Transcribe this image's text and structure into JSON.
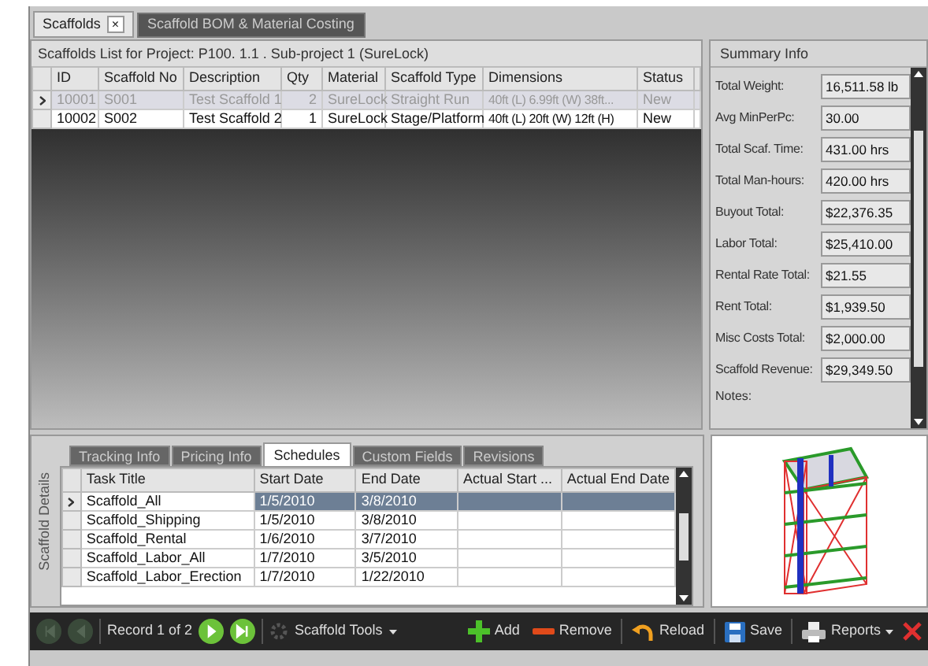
{
  "doc_tabs": [
    {
      "label": "Scaffolds",
      "selected": true,
      "close": "×"
    },
    {
      "label": "Scaffold BOM & Material Costing",
      "selected": false
    }
  ],
  "list_title": "Scaffolds List for Project: P100. 1.1 . Sub-project 1 (SureLock)",
  "scaffolds": {
    "columns": [
      "ID",
      "Scaffold No",
      "Description",
      "Qty",
      "Material",
      "Scaffold Type",
      "Dimensions",
      "Status"
    ],
    "rows": [
      {
        "selected": true,
        "cells": [
          "10001",
          "S001",
          "Test Scaffold 1",
          "2",
          "SureLock",
          "Straight Run",
          "40ft (L) 6.99ft (W) 38ft...",
          "New"
        ]
      },
      {
        "selected": false,
        "cells": [
          "10002",
          "S002",
          "Test Scaffold 2",
          "1",
          "SureLock",
          "Stage/Platform",
          "40ft (L) 20ft (W) 12ft (H)",
          "New"
        ]
      }
    ]
  },
  "summary": {
    "title": "Summary Info",
    "fields": [
      {
        "label": "Total Weight:",
        "value": "16,511.58 lb"
      },
      {
        "label": "Avg MinPerPc:",
        "value": "30.00"
      },
      {
        "label": "Total Scaf. Time:",
        "value": "431.00 hrs"
      },
      {
        "label": "Total Man-hours:",
        "value": "420.00 hrs"
      },
      {
        "label": "Buyout Total:",
        "value": "$22,376.35"
      },
      {
        "label": "Labor Total:",
        "value": "$25,410.00"
      },
      {
        "label": "Rental Rate Total:",
        "value": "$21.55"
      },
      {
        "label": "Rent Total:",
        "value": "$1,939.50"
      },
      {
        "label": "Misc Costs Total:",
        "value": "$2,000.00"
      },
      {
        "label": "Scaffold Revenue:",
        "value": "$29,349.50"
      }
    ],
    "notes_label": "Notes:"
  },
  "details_label": "Scaffold Details",
  "detail_tabs": [
    {
      "label": "Tracking Info",
      "selected": false
    },
    {
      "label": "Pricing Info",
      "selected": false
    },
    {
      "label": "Schedules",
      "selected": true
    },
    {
      "label": "Custom Fields",
      "selected": false
    },
    {
      "label": "Revisions",
      "selected": false
    }
  ],
  "schedules": {
    "columns": [
      "Task Title",
      "Start Date",
      "End Date",
      "Actual Start ...",
      "Actual End Date"
    ],
    "rows": [
      {
        "selected": true,
        "cells": [
          "Scaffold_All",
          "1/5/2010",
          "3/8/2010",
          "",
          ""
        ]
      },
      {
        "selected": false,
        "cells": [
          "Scaffold_Shipping",
          "1/5/2010",
          "3/8/2010",
          "",
          ""
        ]
      },
      {
        "selected": false,
        "cells": [
          "Scaffold_Rental",
          "1/6/2010",
          "3/7/2010",
          "",
          ""
        ]
      },
      {
        "selected": false,
        "cells": [
          "Scaffold_Labor_All",
          "1/7/2010",
          "3/5/2010",
          "",
          ""
        ]
      },
      {
        "selected": false,
        "cells": [
          "Scaffold_Labor_Erection",
          "1/7/2010",
          "1/22/2010",
          "",
          ""
        ]
      }
    ]
  },
  "toolbar": {
    "nav": [
      {
        "kind": "first",
        "disabled": true
      },
      {
        "kind": "prev",
        "disabled": true
      }
    ],
    "record": "Record 1 of 2",
    "nav2": [
      {
        "kind": "next",
        "disabled": false
      },
      {
        "kind": "last",
        "disabled": false
      }
    ],
    "tools": "Scaffold Tools",
    "actions": [
      {
        "kind": "add",
        "label": "Add"
      },
      {
        "kind": "remove",
        "label": "Remove"
      },
      {
        "kind": "reload",
        "label": "Reload"
      },
      {
        "kind": "save",
        "label": "Save"
      },
      {
        "kind": "reports",
        "label": "Reports"
      }
    ]
  }
}
